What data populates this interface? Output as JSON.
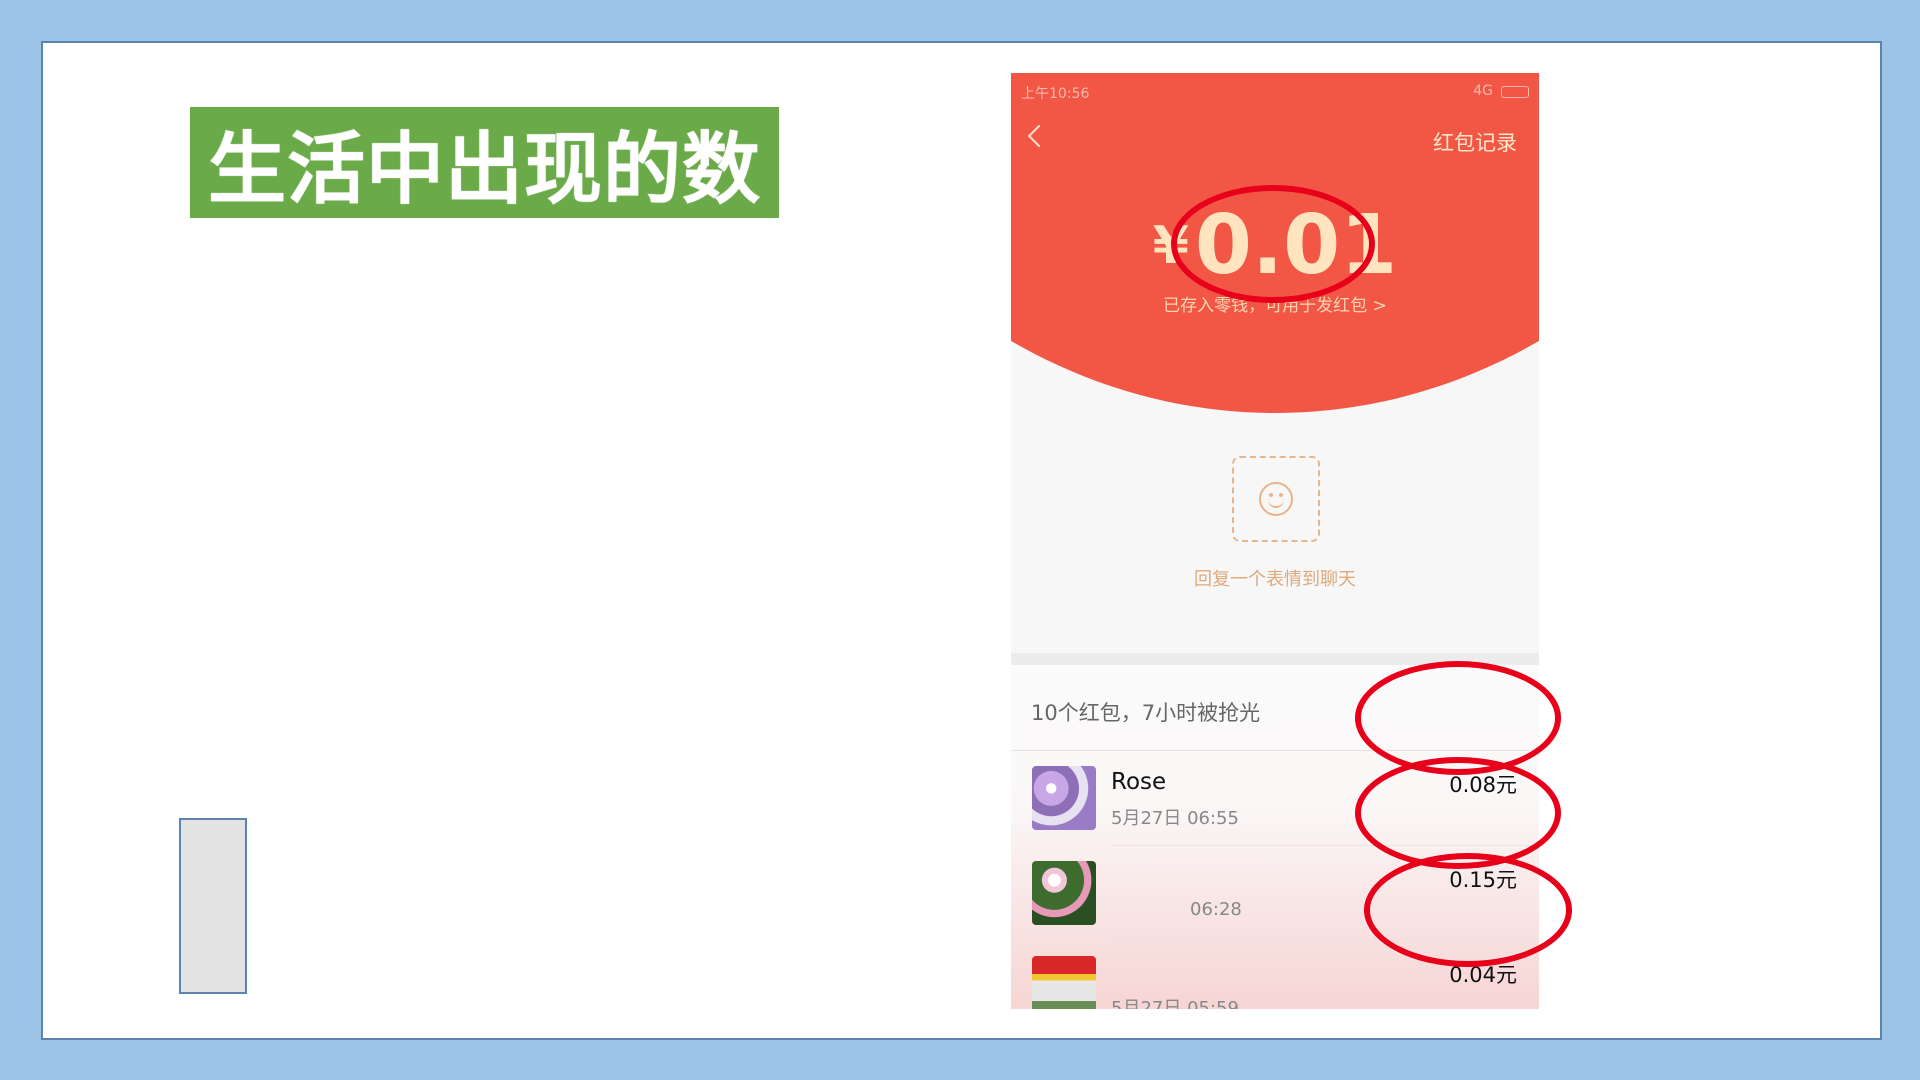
{
  "slide": {
    "title": "生活中出现的数"
  },
  "phone": {
    "status_time": "上午10:56",
    "status_signal": "4G",
    "header_right": "红包记录",
    "amount_symbol": "¥",
    "amount_value": "0.01",
    "saved_text": "已存入零钱，可用于发红包 >",
    "reply_text": "回复一个表情到聊天",
    "summary": "10个红包，7小时被抢光",
    "rows": [
      {
        "name": "Rose",
        "time": "5月27日  06:55",
        "amount": "0.08元"
      },
      {
        "name": "",
        "time": "06:28",
        "amount": "0.15元"
      },
      {
        "name": "",
        "time": "5月27日  05:59",
        "amount": "0.04元"
      }
    ]
  },
  "colors": {
    "background": "#9dc3e6",
    "title_bg": "#6aaa48",
    "red_packet": "#f25746",
    "highlight_circle": "#e8001b"
  },
  "icons": [
    "back-chevron-icon",
    "smile-face-icon",
    "battery-icon",
    "alarm-icon"
  ]
}
